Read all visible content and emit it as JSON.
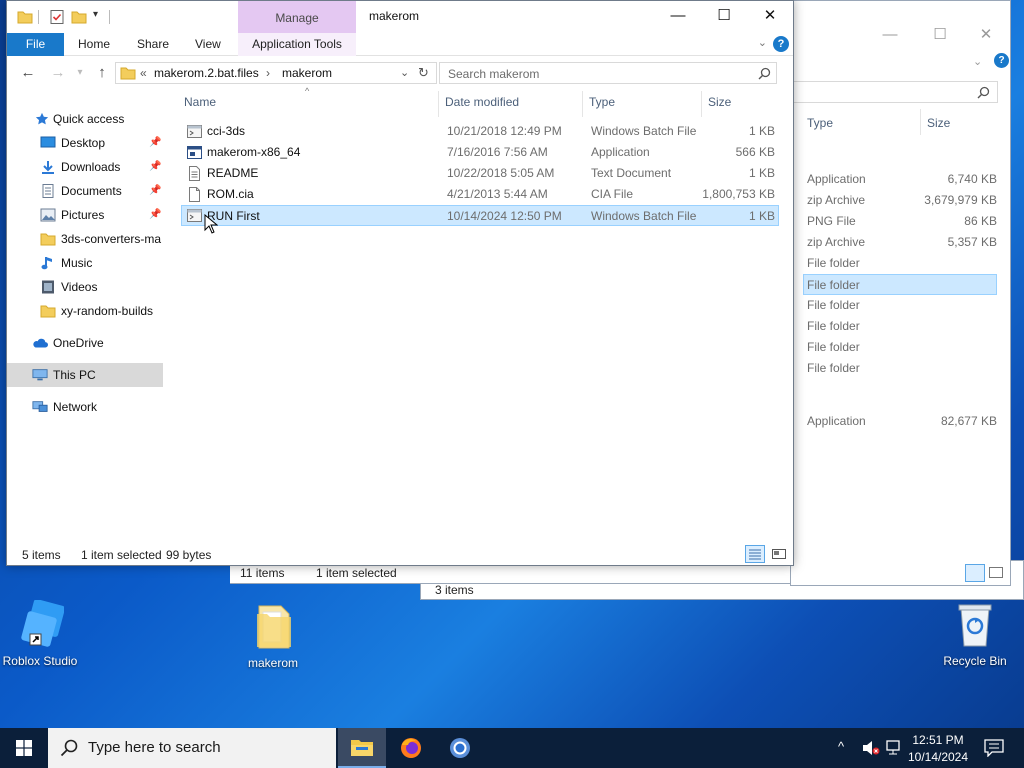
{
  "main_window": {
    "manage_tab": "Manage",
    "title": "makerom",
    "ribbon_tabs": [
      "File",
      "Home",
      "Share",
      "View",
      "Application Tools"
    ],
    "address": {
      "overflow": "«",
      "segments": [
        "makerom.2.bat.files",
        "makerom"
      ]
    },
    "search_placeholder": "Search makerom",
    "sidebar": {
      "quick_access": "Quick access",
      "items": [
        {
          "label": "Desktop",
          "icon": "desktop-icon",
          "pinned": true
        },
        {
          "label": "Downloads",
          "icon": "downloads-icon",
          "pinned": true
        },
        {
          "label": "Documents",
          "icon": "documents-icon",
          "pinned": true
        },
        {
          "label": "Pictures",
          "icon": "pictures-icon",
          "pinned": true
        },
        {
          "label": "3ds-converters-ma",
          "icon": "folder-icon",
          "pinned": false
        },
        {
          "label": "Music",
          "icon": "music-icon",
          "pinned": false
        },
        {
          "label": "Videos",
          "icon": "videos-icon",
          "pinned": false
        },
        {
          "label": "xy-random-builds",
          "icon": "folder-icon",
          "pinned": false
        }
      ],
      "onedrive": "OneDrive",
      "this_pc": "This PC",
      "network": "Network"
    },
    "columns": {
      "name": "Name",
      "date": "Date modified",
      "type": "Type",
      "size": "Size"
    },
    "files": [
      {
        "name": "cci-3ds",
        "date": "10/21/2018 12:49 PM",
        "type": "Windows Batch File",
        "size": "1 KB",
        "icon": "batch-file-icon"
      },
      {
        "name": "makerom-x86_64",
        "date": "7/16/2016 7:56 AM",
        "type": "Application",
        "size": "566 KB",
        "icon": "application-icon"
      },
      {
        "name": "README",
        "date": "10/22/2018 5:05 AM",
        "type": "Text Document",
        "size": "1 KB",
        "icon": "text-file-icon"
      },
      {
        "name": "ROM.cia",
        "date": "4/21/2013 5:44 AM",
        "type": "CIA File",
        "size": "1,800,753 KB",
        "icon": "generic-file-icon"
      },
      {
        "name": "RUN First",
        "date": "10/14/2024 12:50 PM",
        "type": "Windows Batch File",
        "size": "1 KB",
        "icon": "batch-file-icon",
        "selected": true
      }
    ],
    "status": {
      "items": "5 items",
      "selected": "1 item selected",
      "bytes": "99 bytes"
    }
  },
  "back_window_1": {
    "columns": {
      "type": "Type",
      "size": "Size"
    },
    "rows": [
      {
        "type": "Application",
        "size": "6,740 KB"
      },
      {
        "type": "zip Archive",
        "size": "3,679,979 KB"
      },
      {
        "type": "PNG File",
        "size": "86 KB"
      },
      {
        "type": "zip Archive",
        "size": "5,357 KB"
      },
      {
        "type": "File folder",
        "size": ""
      },
      {
        "type": "File folder",
        "size": "",
        "selected": true
      },
      {
        "type": "File folder",
        "size": ""
      },
      {
        "type": "File folder",
        "size": ""
      },
      {
        "type": "File folder",
        "size": ""
      },
      {
        "type": "File folder",
        "size": ""
      },
      {
        "type": "Application",
        "size": "82,677 KB"
      }
    ]
  },
  "back_window_2": {
    "items": "11 items",
    "selected": "1 item selected"
  },
  "back_window_3": {
    "items": "3 items"
  },
  "desktop_icons": [
    {
      "label": "Roblox Studio",
      "icon": "roblox-studio-icon"
    },
    {
      "label": "makerom",
      "icon": "folder-icon"
    },
    {
      "label": "Recycle Bin",
      "icon": "recycle-bin-icon"
    }
  ],
  "taskbar": {
    "search_placeholder": "Type here to search",
    "apps": [
      "file-explorer-icon",
      "firefox-icon",
      "chrome-icon"
    ],
    "time": "12:51 PM",
    "date": "10/14/2024"
  },
  "colors": {
    "accent": "#1979ca",
    "selection": "#cce8ff",
    "manage_tab": "#e4c8f2",
    "taskbar": "#0b1f3a"
  }
}
